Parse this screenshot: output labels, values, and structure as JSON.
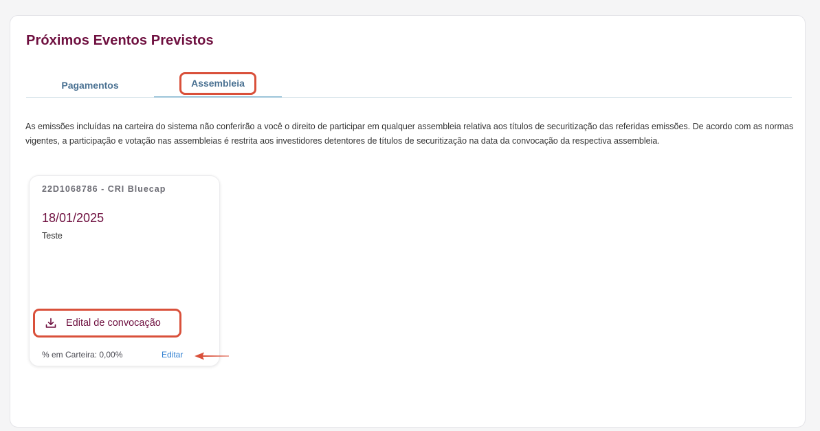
{
  "section": {
    "title": "Próximos Eventos Previstos"
  },
  "tabs": [
    {
      "label": "Pagamentos",
      "active": false
    },
    {
      "label": "Assembleia",
      "active": true
    }
  ],
  "disclaimer": "As emissões incluídas na carteira do sistema não conferirão a você o direito de participar em qualquer assembleia relativa aos títulos de securitização das referidas emissões. De acordo com as normas vigentes, a participação e votação nas assembleias é restrita aos investidores detentores de títulos de securitização na data da convocação da respectiva assembleia.",
  "card": {
    "code": "22D1068786 - CRI Bluecap",
    "date": "18/01/2025",
    "description": "Teste",
    "download_label": "Edital de convocação",
    "download_icon": "download-icon",
    "carteira": "% em Carteira: 0,00%",
    "edit_label": "Editar"
  },
  "colors": {
    "brand": "#6e0f3f",
    "tab_text": "#4a7192",
    "highlight": "#d9503a",
    "link": "#2f7fd0"
  }
}
